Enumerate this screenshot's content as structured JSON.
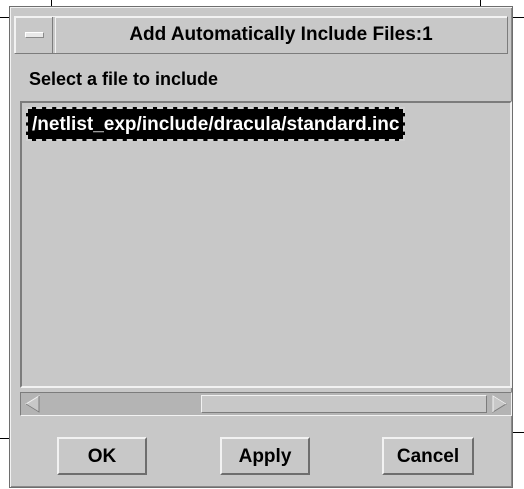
{
  "window": {
    "title": "Add Automatically Include Files:1"
  },
  "dialog": {
    "prompt": "Select a file to include",
    "files": [
      "/netlist_exp/include/dracula/standard.inc"
    ],
    "selected_index": 0
  },
  "buttons": {
    "ok": "OK",
    "apply": "Apply",
    "cancel": "Cancel"
  },
  "icons": {
    "window_menu": "window-menu-icon",
    "scroll_left": "arrow-left-icon",
    "scroll_right": "arrow-right-icon"
  }
}
